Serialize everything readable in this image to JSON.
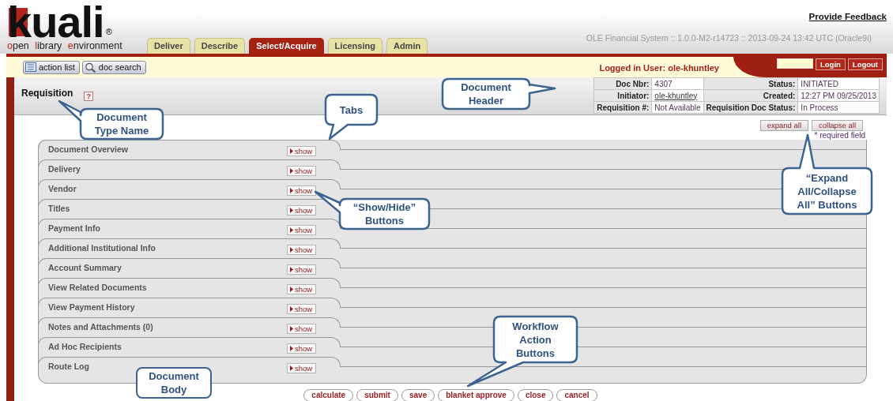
{
  "logo": {
    "wordmark": "kuali",
    "mark": "®",
    "tagline": [
      "open",
      "library",
      "environment"
    ]
  },
  "header": {
    "feedback_link": "Provide Feedback",
    "version": "OLE Financial System :: 1.0.0-M2-r14723 :: 2013-09-24 13:42 UTC (Oracle9i)"
  },
  "nav_tabs": [
    {
      "label": "Deliver",
      "selected": false
    },
    {
      "label": "Describe",
      "selected": false
    },
    {
      "label": "Select/Acquire",
      "selected": true
    },
    {
      "label": "Licensing",
      "selected": false
    },
    {
      "label": "Admin",
      "selected": false
    }
  ],
  "toolbar": {
    "buttons": [
      {
        "label": "action list",
        "kind": "list"
      },
      {
        "label": "doc search",
        "kind": "search"
      }
    ],
    "logged_in": "Logged in User: ole-khuntley",
    "login_buttons": [
      "Login",
      "Logout"
    ]
  },
  "document": {
    "title": "Requisition",
    "help": "?",
    "header_rows": [
      [
        {
          "label": "Doc Nbr:",
          "value": "4307",
          "kind": "text"
        },
        {
          "label": "Status:",
          "value": "INITIATED",
          "kind": "text"
        }
      ],
      [
        {
          "label": "Initiator:",
          "value": "ole-khuntley",
          "kind": "link"
        },
        {
          "label": "Created:",
          "value": "12:27 PM 09/25/2013",
          "kind": "text"
        }
      ],
      [
        {
          "label": "Requisition #:",
          "value": "Not Available",
          "kind": "text"
        },
        {
          "label": "Requisition Doc Status:",
          "value": "In Process",
          "kind": "text"
        }
      ]
    ]
  },
  "expand_buttons": [
    "expand all",
    "collapse all"
  ],
  "required_note": "* required field",
  "sections": [
    {
      "title": "Document Overview",
      "button": "show"
    },
    {
      "title": "Delivery",
      "button": "show"
    },
    {
      "title": "Vendor",
      "button": "show"
    },
    {
      "title": "Titles",
      "button": "show"
    },
    {
      "title": "Payment Info",
      "button": "show"
    },
    {
      "title": "Additional Institutional Info",
      "button": "show"
    },
    {
      "title": "Account Summary",
      "button": "show"
    },
    {
      "title": "View Related Documents",
      "button": "show"
    },
    {
      "title": "View Payment History",
      "button": "show"
    },
    {
      "title": "Notes and Attachments (0)",
      "button": "show"
    },
    {
      "title": "Ad Hoc Recipients",
      "button": "show"
    },
    {
      "title": "Route Log",
      "button": "show"
    }
  ],
  "actions": [
    "calculate",
    "submit",
    "save",
    "blanket approve",
    "close",
    "cancel"
  ],
  "callouts": [
    "Document Type Name",
    "Tabs",
    "Document Header",
    "“Expand All/Collapse All” Buttons",
    "“Show/Hide” Buttons",
    "Workflow Action Buttons",
    "Document Body"
  ]
}
